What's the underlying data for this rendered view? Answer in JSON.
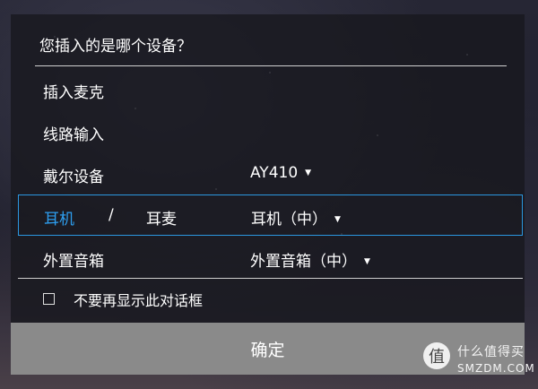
{
  "dialog": {
    "title": "您插入的是哪个设备？",
    "rows": [
      {
        "label": "插入麦克",
        "value": ""
      },
      {
        "label": "线路输入",
        "value": ""
      },
      {
        "label": "戴尔设备",
        "value": "AY410"
      },
      {
        "label": "耳机",
        "separator": "/",
        "label2": "耳麦",
        "value": "耳机（中）",
        "selected": true
      },
      {
        "label": "外置音箱",
        "value": "外置音箱（中）"
      }
    ],
    "dropdown_icon": "chevron-down-icon",
    "checkbox_label": "不要再显示此对话框",
    "confirm_label": "确定"
  },
  "watermark": {
    "badge": "值",
    "text": "什么值得买",
    "sub": "SMZDM.COM"
  },
  "colors": {
    "accent": "#2b97e0",
    "confirm_bg": "#8a8a8a"
  }
}
